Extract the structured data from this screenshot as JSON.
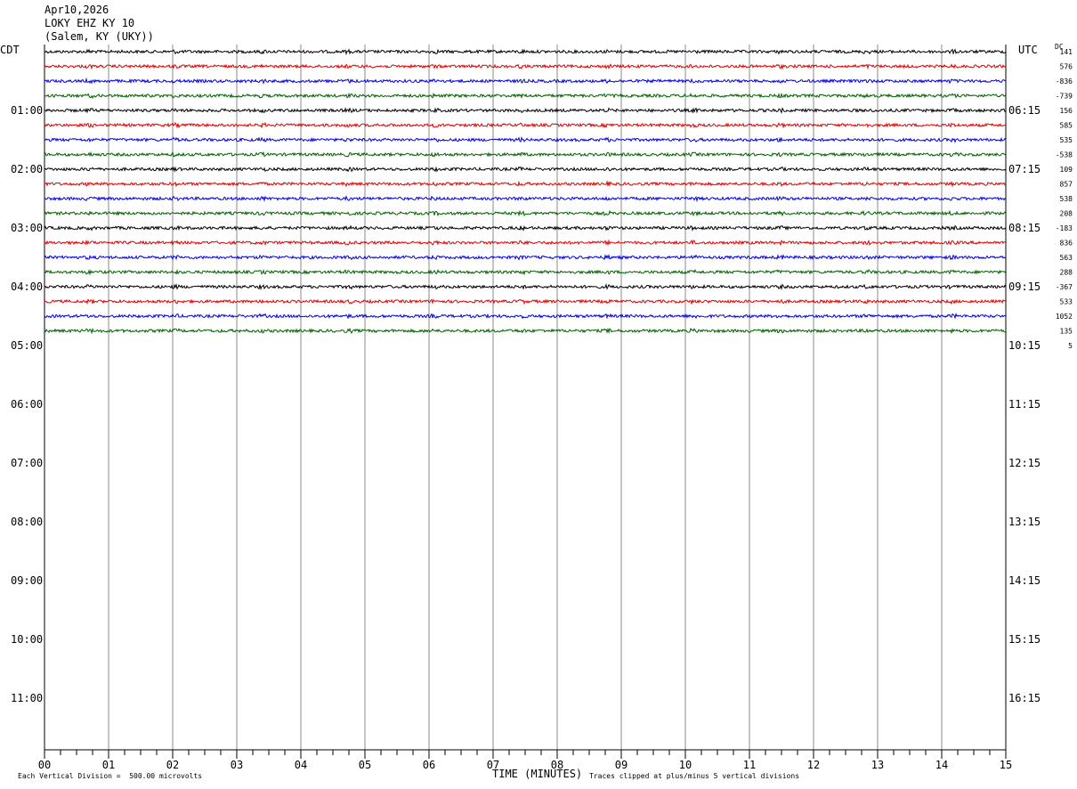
{
  "header": {
    "date": "Apr10,2026",
    "station": "LOKY EHZ KY 10",
    "location": "(Salem, KY (UKY))"
  },
  "labels": {
    "left_tz": "CDT",
    "right_tz": "UTC",
    "dc": "DC",
    "x_axis_title": "TIME (MINUTES)",
    "scale_note": "Each Vertical Division =  500.00 microvolts",
    "clip_note": "Traces clipped at plus/minus 5 vertical divisions"
  },
  "chart_data": {
    "type": "line",
    "title": "LOKY EHZ KY 10",
    "xlabel": "TIME (MINUTES)",
    "xlim": [
      0,
      15
    ],
    "x_ticks": [
      "00",
      "01",
      "02",
      "03",
      "04",
      "05",
      "06",
      "07",
      "08",
      "09",
      "10",
      "11",
      "12",
      "13",
      "14",
      "15"
    ],
    "left_hour_labels": [
      "01:00",
      "02:00",
      "03:00",
      "04:00",
      "05:00",
      "06:00",
      "07:00",
      "08:00",
      "09:00",
      "10:00",
      "11:00"
    ],
    "right_hour_labels": [
      "06:15",
      "07:15",
      "08:15",
      "09:15",
      "10:15",
      "11:15",
      "12:15",
      "13:15",
      "14:15",
      "15:15",
      "16:15"
    ],
    "trace_colors": [
      "#000000",
      "#e00000",
      "#0000e0",
      "#006000"
    ],
    "traces_recorded": 20,
    "dc_offsets": [
      "141",
      "576",
      "-836",
      "-739",
      "156",
      "585",
      "535",
      "-538",
      "109",
      "857",
      "538",
      "208",
      "-183",
      "836",
      "563",
      "288",
      "-367",
      "533",
      "1052",
      "135",
      "5"
    ],
    "amplitude_note": "Each Vertical Division = 500.00 microvolts",
    "grid": true
  }
}
